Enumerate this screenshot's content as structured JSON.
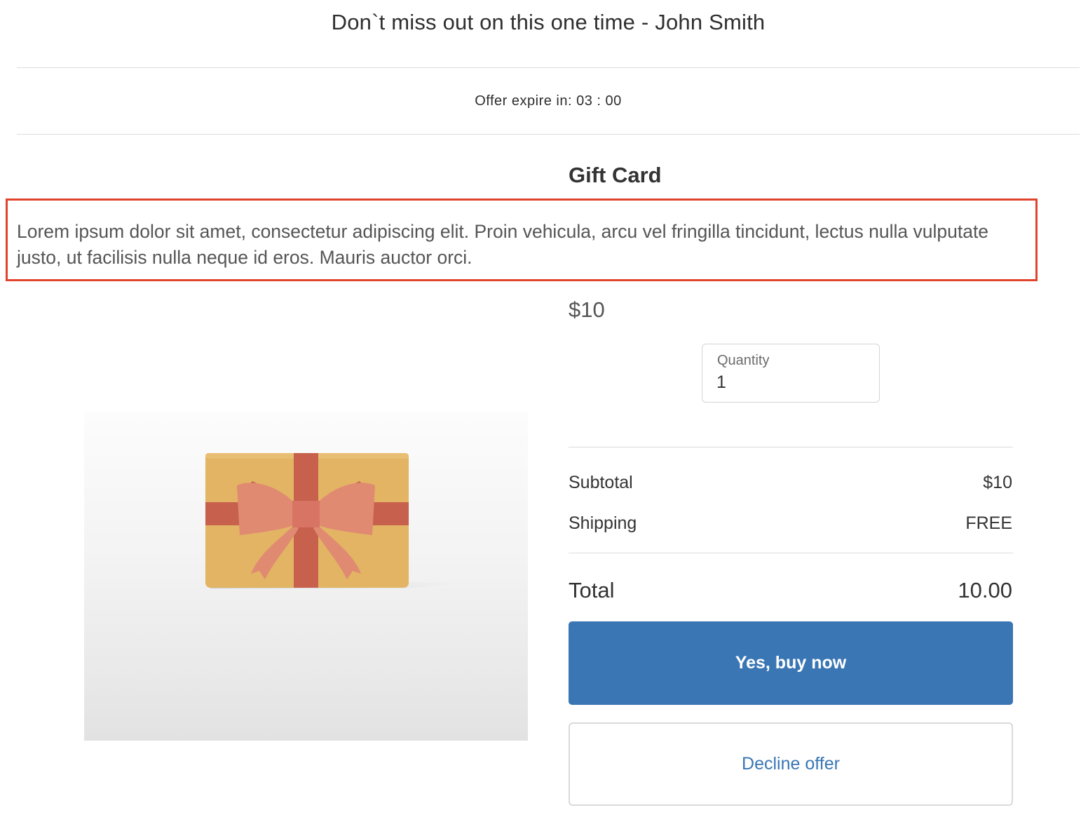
{
  "header": {
    "title": "Don`t miss out on this one time - John Smith"
  },
  "timer": {
    "text": "Offer expire in: 03 : 00"
  },
  "product": {
    "title": "Gift Card",
    "description": "Lorem ipsum dolor sit amet, consectetur adipiscing elit. Proin vehicula, arcu vel fringilla tincidunt, lectus nulla vulputate justo, ut facilisis nulla neque id eros. Mauris auctor orci.",
    "price": "$10",
    "image_icon": "gift-card-icon"
  },
  "quantity": {
    "label": "Quantity",
    "value": "1"
  },
  "summary": {
    "subtotal_label": "Subtotal",
    "subtotal_value": "$10",
    "shipping_label": "Shipping",
    "shipping_value": "FREE",
    "total_label": "Total",
    "total_value": "10.00"
  },
  "actions": {
    "buy_label": "Yes, buy now",
    "decline_label": "Decline offer"
  },
  "colors": {
    "primary": "#3a76b4",
    "highlight_border": "#e0442d",
    "gift_card": "#e2b464",
    "ribbon": "#c8604e",
    "bow": "#e08a72"
  }
}
